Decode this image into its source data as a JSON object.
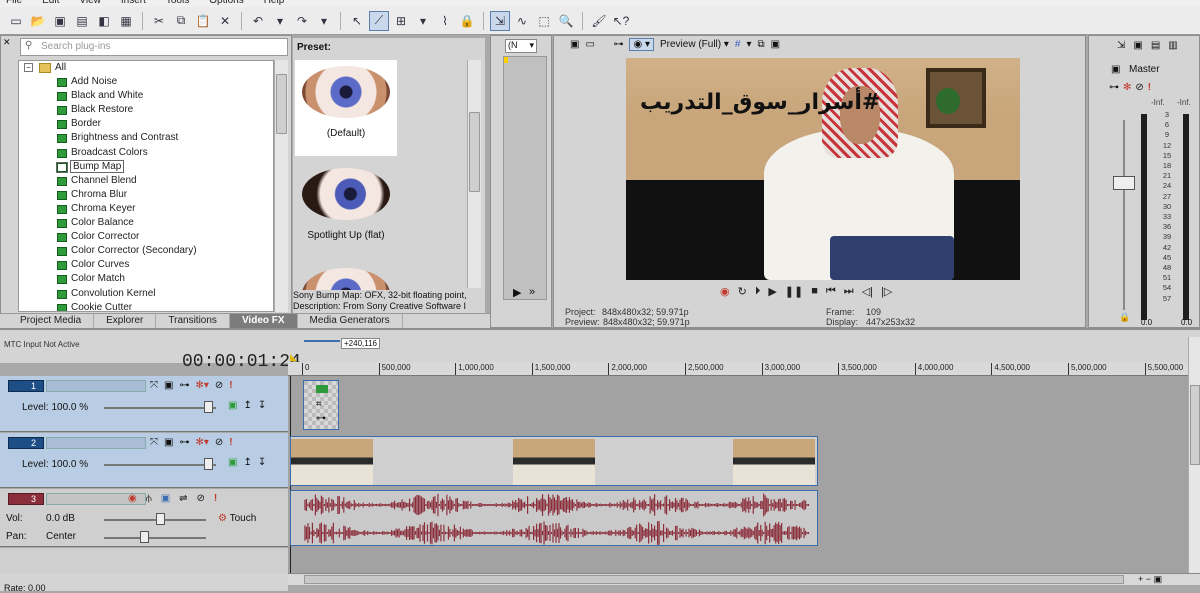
{
  "menu": [
    "File",
    "Edit",
    "View",
    "Insert",
    "Tools",
    "Options",
    "Help"
  ],
  "search": {
    "placeholder": "Search plug-ins"
  },
  "fx_tree": {
    "root": "All",
    "items": [
      "Add Noise",
      "Black and White",
      "Black Restore",
      "Border",
      "Brightness and Contrast",
      "Broadcast Colors",
      "Bump Map",
      "Channel Blend",
      "Chroma Blur",
      "Chroma Keyer",
      "Color Balance",
      "Color Corrector",
      "Color Corrector (Secondary)",
      "Color Curves",
      "Color Match",
      "Convolution Kernel",
      "Cookie Cutter"
    ],
    "selected_index": 6
  },
  "preset": {
    "header": "Preset:",
    "items": [
      "(Default)",
      "Spotlight Up (flat)"
    ],
    "desc1": "Sony Bump Map: OFX, 32-bit floating point,",
    "desc2": "Description: From Sony Creative Software I"
  },
  "tabs": [
    "Project Media",
    "Explorer",
    "Transitions",
    "Video FX",
    "Media Generators"
  ],
  "active_tab": "Video FX",
  "trimmer": {
    "dropdown": "(N"
  },
  "preview": {
    "mode": "Preview (Full)",
    "overlay_text": "#أسرار_سوق_التدريب",
    "project_label": "Project:",
    "project_value": "848x480x32; 59.971p",
    "preview_label": "Preview:",
    "preview_value": "848x480x32; 59.971p",
    "frame_label": "Frame:",
    "frame_value": "109",
    "display_label": "Display:",
    "display_value": "447x253x32"
  },
  "mixer": {
    "title": "Master",
    "scale": [
      "-Inf.",
      "3",
      "6",
      "9",
      "12",
      "15",
      "18",
      "21",
      "24",
      "27",
      "30",
      "33",
      "36",
      "39",
      "42",
      "45",
      "48",
      "51",
      "54",
      "57"
    ],
    "left_value": "0.0",
    "right_value": "0.0",
    "inf_left": "-Inf.",
    "inf_right": "-Inf."
  },
  "timeline": {
    "mtc": "MTC Input Not Active",
    "timecode": "00:00:01:24",
    "marker": "+240,116",
    "ruler": [
      "0",
      "500,000",
      "1,000,000",
      "1,500,000",
      "2,000,000",
      "2,500,000",
      "3,000,000",
      "3,500,000",
      "4,000,000",
      "4,500,000",
      "5,000,000",
      "5,500,000"
    ]
  },
  "tracks": [
    {
      "num": "1",
      "level_label": "Level:",
      "level_value": "100.0 %"
    },
    {
      "num": "2",
      "level_label": "Level:",
      "level_value": "100.0 %"
    },
    {
      "num": "3",
      "vol_label": "Vol:",
      "vol_value": "0.0 dB",
      "pan_label": "Pan:",
      "pan_value": "Center",
      "mode": "Touch"
    }
  ],
  "status": {
    "rate": "Rate: 0.00"
  },
  "colors": {
    "accent": "#1d4e86",
    "waveform": "#8b2e3b",
    "selection": "#b8cde4"
  }
}
